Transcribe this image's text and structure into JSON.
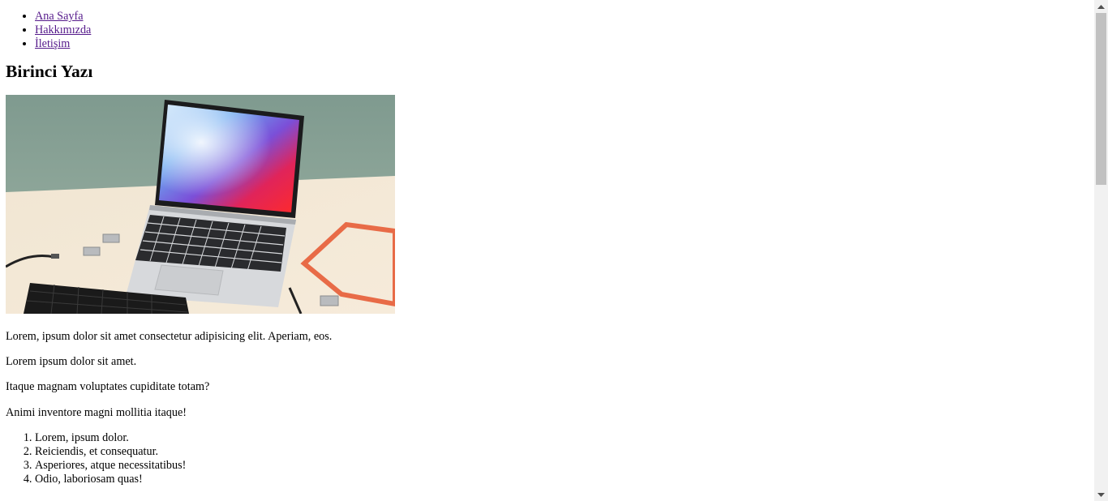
{
  "nav": {
    "items": [
      {
        "label": "Ana Sayfa"
      },
      {
        "label": "Hakkımızda"
      },
      {
        "label": "İletişim"
      }
    ]
  },
  "post": {
    "title": "Birinci Yazı",
    "image_subject": "laptop-on-desk-photo",
    "paragraphs": [
      "Lorem, ipsum dolor sit amet consectetur adipisicing elit. Aperiam, eos.",
      "Lorem ipsum dolor sit amet.",
      "Itaque magnam voluptates cupiditate totam?",
      "Animi inventore magni mollitia itaque!"
    ],
    "list": [
      "Lorem, ipsum dolor.",
      "Reiciendis, et consequatur.",
      "Asperiores, atque necessitatibus!",
      "Odio, laboriosam quas!"
    ]
  },
  "colors": {
    "link_visited": "#551a8b",
    "scroll_track": "#f1f1f1",
    "scroll_thumb": "#c1c1c1"
  }
}
